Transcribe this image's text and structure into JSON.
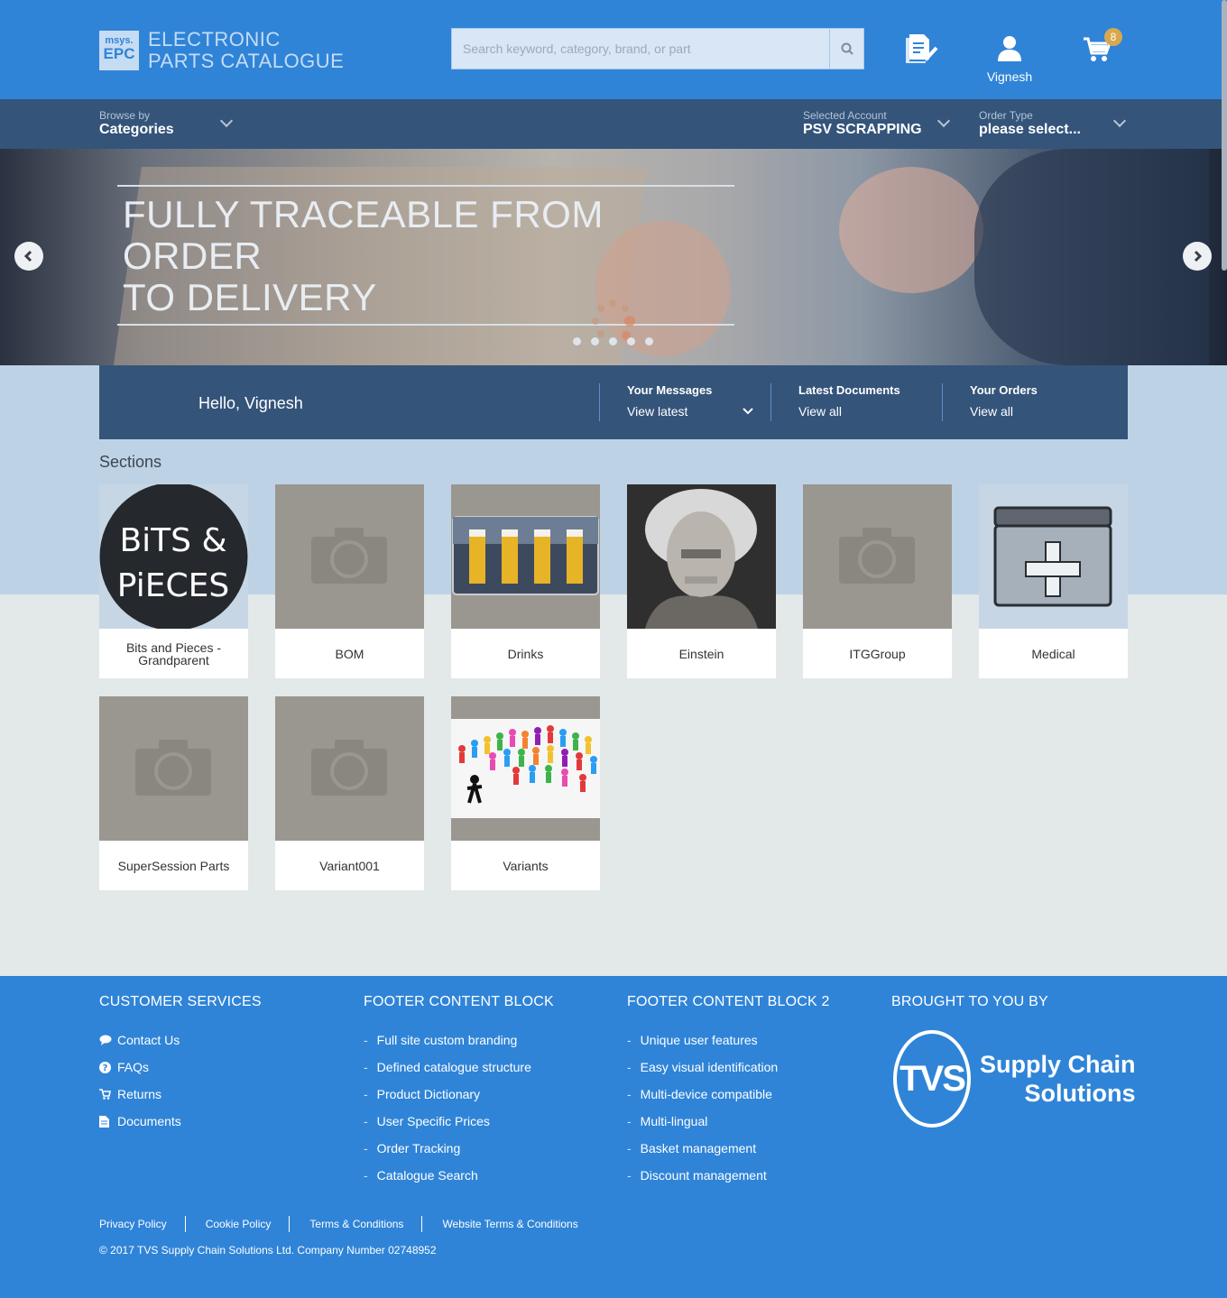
{
  "header": {
    "logo_line1": "msys.",
    "logo_line2": "EPC",
    "logo_title_line1": "ELECTRONIC",
    "logo_title_line2": "PARTS CATALOGUE",
    "search_placeholder": "Search keyword, category, brand, or part",
    "user_name": "Vignesh",
    "cart_count": "8"
  },
  "nav": {
    "browse_label": "Browse by",
    "browse_value": "Categories",
    "account_label": "Selected Account",
    "account_value": "PSV SCRAPPING",
    "order_type_label": "Order Type",
    "order_type_value": "please select..."
  },
  "hero": {
    "title_line1": "FULLY TRACEABLE FROM ORDER",
    "title_line2": "TO DELIVERY",
    "slide_count": 5
  },
  "welcome": {
    "greeting": "Hello, Vignesh",
    "messages_title": "Your Messages",
    "messages_link": "View latest",
    "documents_title": "Latest Documents",
    "documents_link": "View all",
    "orders_title": "Your Orders",
    "orders_link": "View all"
  },
  "sections": {
    "title": "Sections",
    "items": [
      {
        "label": "Bits and Pieces - Grandparent",
        "image": "bits-and-pieces-logo"
      },
      {
        "label": "BOM",
        "image": "placeholder-camera"
      },
      {
        "label": "Drinks",
        "image": "beer-glasses"
      },
      {
        "label": "Einstein",
        "image": "einstein-portrait"
      },
      {
        "label": "ITGGroup",
        "image": "placeholder-camera"
      },
      {
        "label": "Medical",
        "image": "medical-box"
      },
      {
        "label": "SuperSession Parts",
        "image": "placeholder-camera"
      },
      {
        "label": "Variant001",
        "image": "placeholder-camera"
      },
      {
        "label": "Variants",
        "image": "colorful-figures"
      }
    ],
    "bits_logo_line1": "BiTS &",
    "bits_logo_line2": "PiECES"
  },
  "footer": {
    "col1_title": "CUSTOMER SERVICES",
    "col1_items": [
      "Contact Us",
      "FAQs",
      "Returns",
      "Documents"
    ],
    "col2_title": "FOOTER CONTENT BLOCK",
    "col2_items": [
      "Full site custom branding",
      "Defined catalogue structure",
      "Product Dictionary",
      "User Specific Prices",
      "Order Tracking",
      "Catalogue Search"
    ],
    "col3_title": "FOOTER CONTENT BLOCK 2",
    "col3_items": [
      "Unique user features",
      "Easy visual identification",
      "Multi-device compatible",
      "Multi-lingual",
      "Basket management",
      "Discount management"
    ],
    "col4_title": "BROUGHT TO YOU BY",
    "tvs_mark": "TVS",
    "tvs_line1": "Supply Chain",
    "tvs_line2": "Solutions",
    "legal_links": [
      "Privacy Policy",
      "Cookie Policy",
      "Terms & Conditions",
      "Website Terms & Conditions"
    ],
    "copyright": "© 2017 TVS Supply Chain Solutions Ltd. Company Number 02748952"
  },
  "colors": {
    "primary_blue": "#2f84d8",
    "nav_navy": "#34547a",
    "badge_gold": "#d7a84e",
    "page_bg": "#e3e8e9"
  }
}
